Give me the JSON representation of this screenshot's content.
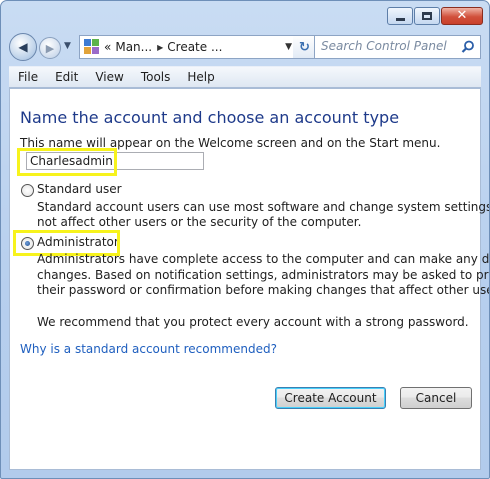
{
  "window": {
    "close_glyph": "✕",
    "minimize_icon": "minimize-icon",
    "maximize_icon": "maximize-icon"
  },
  "nav": {
    "back_glyph": "◀",
    "forward_glyph": "▶",
    "history_glyph": "▼",
    "address_prefix": "«",
    "crumbs": [
      "Man...",
      "Create ..."
    ],
    "crumb_sep": "▶",
    "address_dropdown": "▼",
    "refresh_glyph": "↻",
    "search_placeholder": "Search Control Panel"
  },
  "menu": [
    "File",
    "Edit",
    "View",
    "Tools",
    "Help"
  ],
  "dialog": {
    "heading": "Name the account and choose an account type",
    "intro": "This name will appear on the Welcome screen and on the Start menu.",
    "account_name": "Charlesadmin",
    "standard": {
      "label": "Standard user",
      "desc1": "Standard account users can use most software and change system settings that do",
      "desc2": "not affect other users or the security of the computer."
    },
    "admin": {
      "label": "Administrator",
      "desc1": "Administrators have complete access to the computer and can make any desired",
      "desc2": "changes. Based on notification settings, administrators may be asked to provide",
      "desc3": "their password or confirmation before making changes that affect other users.",
      "recommend": "We recommend that you protect every account with a strong password."
    },
    "selected_type": "Administrator",
    "help_link": "Why is a standard account recommended?",
    "create_button": "Create Account",
    "cancel_button": "Cancel"
  },
  "colors": {
    "heading": "#1e3a8a",
    "link": "#1f5fbf",
    "highlight": "#f7f31c"
  }
}
